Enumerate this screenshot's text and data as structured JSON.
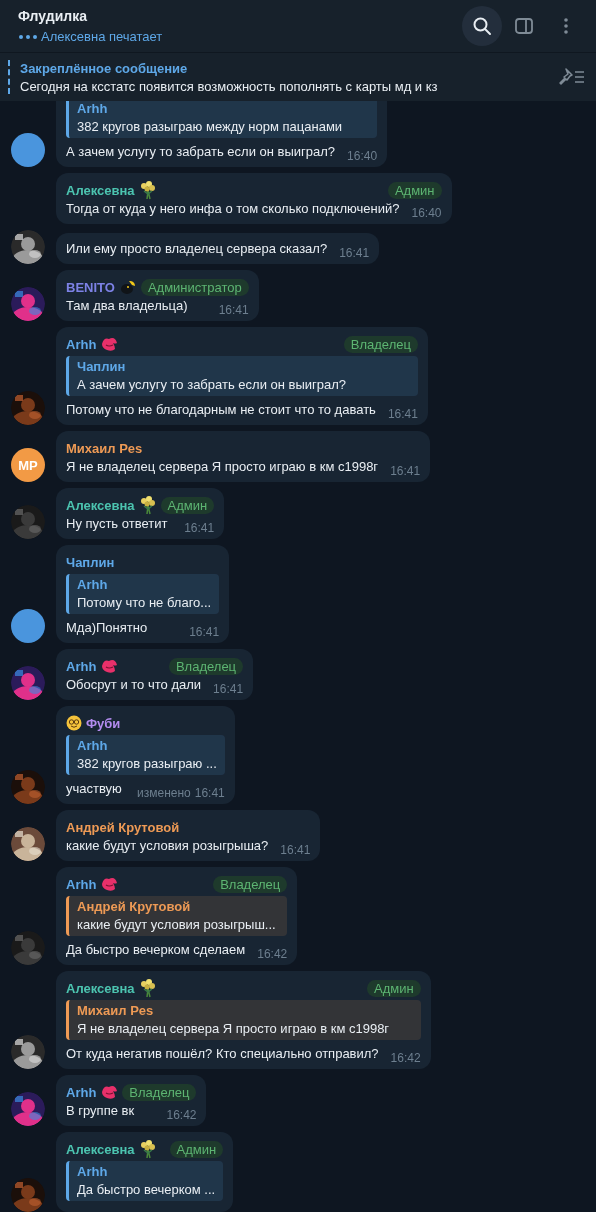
{
  "header": {
    "title": "Флудилка",
    "typing": "Алексевна печатает"
  },
  "pinned": {
    "title": "Закреплённое сообщение",
    "text": "Сегодня на ксстатс появится возможность пополнять с карты мд и кз"
  },
  "messages": [
    {
      "reply": {
        "author": "Arhh",
        "color": "#5ea8e8",
        "text": "382 кругов разыграю между норм пацанами"
      },
      "text": "А зачем услугу то забрать если он выиграл?",
      "time": "16:40",
      "avatar": {
        "kind": "plain",
        "color": "#4a95dd"
      }
    },
    {
      "sender": {
        "name": "Алексевна",
        "color": "#4cc4b0",
        "kind": "bouquet",
        "badge": "Админ"
      },
      "text": "Тогда от куда у него инфа о том сколько подключений?",
      "time": "16:40"
    },
    {
      "text": "Или ему просто владелец сервера сказал?",
      "time": "16:41"
    },
    {
      "sender": {
        "name": "BENITO",
        "color": "#7d82e6",
        "kind": "bird",
        "badge": "Администратор"
      },
      "text": "Там два владельца)",
      "time": "16:41"
    },
    {
      "sender": {
        "name": "Arhh",
        "color": "#5ea8e8",
        "kind": "lips",
        "badge": "Владелец"
      },
      "reply": {
        "author": "Чаплин",
        "color": "#5ea8e8",
        "text": "А зачем услугу то забрать если он выиграл?"
      },
      "text": "Потому что не благодарным не стоит что то давать",
      "time": "16:41"
    },
    {
      "sender": {
        "name": "Михаил Pes",
        "color": "#ee9a55"
      },
      "text": "Я не владелец сервера Я просто играю в км с1998г",
      "time": "16:41",
      "avatar": {
        "kind": "initials",
        "initials": "MP",
        "color": "#f29a45"
      }
    },
    {
      "sender": {
        "name": "Алексевна",
        "color": "#4cc4b0",
        "kind": "bouquet",
        "badge": "Админ"
      },
      "text": "Ну пусть ответит",
      "time": "16:41"
    },
    {
      "sender": {
        "name": "Чаплин",
        "color": "#5ea8e8"
      },
      "reply": {
        "author": "Arhh",
        "color": "#5ea8e8",
        "text": "Потому что не благо..."
      },
      "text": "Мда)Понятно",
      "time": "16:41",
      "avatar": {
        "kind": "plain",
        "color": "#4a95dd"
      }
    },
    {
      "sender": {
        "name": "Arhh",
        "color": "#5ea8e8",
        "kind": "lips",
        "badge": "Владелец"
      },
      "text": "Обосрут и то что дали",
      "time": "16:41"
    },
    {
      "sender": {
        "name": "Фуби",
        "color": "#b48cf0",
        "kind": "smiley"
      },
      "reply": {
        "author": "Arhh",
        "color": "#5ea8e8",
        "text": "382 кругов разыграю ..."
      },
      "text": "участвую",
      "edited": "изменено",
      "time": "16:41"
    },
    {
      "sender": {
        "name": "Андрей Крутовой",
        "color": "#ee9a55"
      },
      "text": "какие будут условия розыгрыша?",
      "time": "16:41"
    },
    {
      "sender": {
        "name": "Arhh",
        "color": "#5ea8e8",
        "kind": "lips",
        "badge": "Владелец"
      },
      "reply": {
        "author": "Андрей Крутовой",
        "color": "#ee9a55",
        "text": "какие будут условия розыгрыш..."
      },
      "text": "Да быстро вечерком сделаем",
      "time": "16:42"
    },
    {
      "sender": {
        "name": "Алексевна",
        "color": "#4cc4b0",
        "kind": "bouquet",
        "badge": "Админ"
      },
      "reply": {
        "author": "Михаил Pes",
        "color": "#ee9a55",
        "text": "Я не владелец сервера Я просто играю в км с1998г"
      },
      "text": "От куда негатив пошёл? Кто специально отправил?",
      "time": "16:42"
    },
    {
      "sender": {
        "name": "Arhh",
        "color": "#5ea8e8",
        "kind": "lips",
        "badge": "Владелец"
      },
      "text": "В группе вк",
      "time": "16:42"
    },
    {
      "sender": {
        "name": "Алексевна",
        "color": "#4cc4b0",
        "kind": "bouquet",
        "badge": "Админ"
      },
      "reply": {
        "author": "Arhh",
        "color": "#5ea8e8",
        "text": "Да быстро вечерком ..."
      }
    }
  ]
}
